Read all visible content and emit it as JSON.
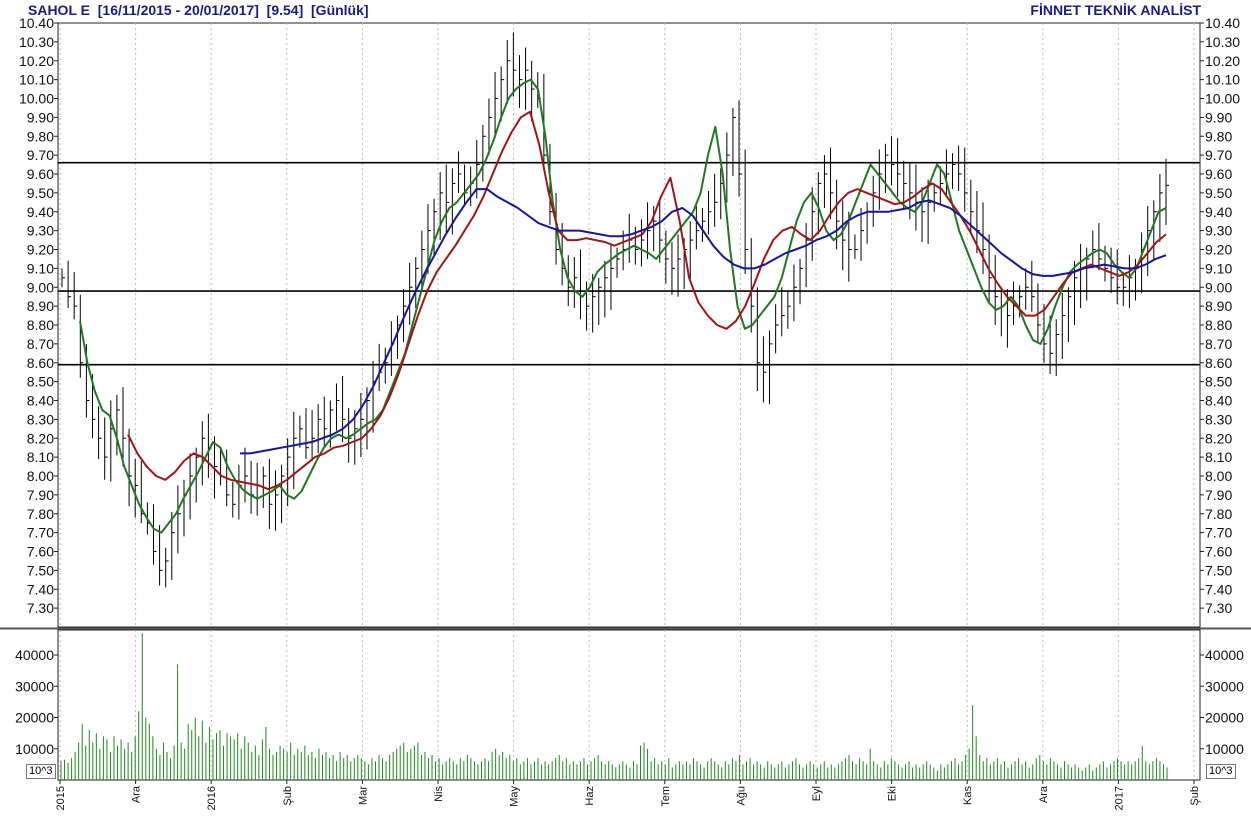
{
  "header": {
    "title": "SAHOL E  [16/11/2015 - 20/01/2017]  [9.54]  [Günlük]",
    "brand": "FİNNET TEKNİK ANALİST"
  },
  "volume_unit": "10^3",
  "colors": {
    "bars": "#000000",
    "ma_short": "#1f7a1f",
    "ma_mid": "#a01616",
    "ma_long": "#16169c",
    "volume": "#1f8a1f",
    "header": "#1a1a8c",
    "reference_lines": "#000000"
  },
  "chart_data": [
    {
      "type": "ohlc",
      "title": "SAHOL E  [16/11/2015 - 20/01/2017]  [9.54]  [Günlük]",
      "ylim": [
        7.2,
        10.4
      ],
      "yticks": [
        7.3,
        7.4,
        7.5,
        7.6,
        7.7,
        7.8,
        7.9,
        8.0,
        8.1,
        8.2,
        8.3,
        8.4,
        8.5,
        8.6,
        8.7,
        8.8,
        8.9,
        9.0,
        9.1,
        9.2,
        9.3,
        9.4,
        9.5,
        9.6,
        9.7,
        9.8,
        9.9,
        10.0,
        10.1,
        10.2,
        10.3,
        10.4
      ],
      "yticklabels": [
        "7.30",
        "7.40",
        "7.50",
        "7.60",
        "7.70",
        "7.80",
        "7.90",
        "8.00",
        "8.10",
        "8.20",
        "8.30",
        "8.40",
        "8.50",
        "8.60",
        "8.70",
        "8.80",
        "8.90",
        "9.00",
        "9.10",
        "9.20",
        "9.30",
        "9.40",
        "9.50",
        "9.60",
        "9.70",
        "9.80",
        "9.90",
        "10.00",
        "10.10",
        "10.20",
        "10.30",
        "10.40"
      ],
      "x_months": [
        "2015",
        "Ara",
        "2016",
        "Şub",
        "Mar",
        "Nis",
        "May",
        "Haz",
        "Tem",
        "Ağu",
        "Eyl",
        "Eki",
        "Kas",
        "Ara",
        "2017",
        "Şub"
      ],
      "horizontal_lines": [
        9.66,
        8.98,
        8.59
      ],
      "close_series": [
        9.05,
        8.95,
        8.9,
        8.6,
        8.4,
        8.3,
        8.2,
        8.1,
        8.25,
        8.35,
        8.2,
        8.0,
        7.95,
        7.8,
        7.75,
        7.6,
        7.5,
        7.55,
        7.7,
        7.8,
        7.9,
        8.0,
        8.1,
        8.2,
        8.15,
        8.05,
        8.0,
        7.9,
        7.85,
        7.95,
        8.0,
        7.9,
        7.95,
        8.0,
        7.85,
        7.9,
        8.0,
        8.1,
        8.2,
        8.25,
        8.15,
        8.2,
        8.3,
        8.25,
        8.35,
        8.4,
        8.3,
        8.2,
        8.25,
        8.3,
        8.4,
        8.5,
        8.55,
        8.6,
        8.7,
        8.8,
        8.9,
        9.0,
        9.1,
        9.2,
        9.3,
        9.4,
        9.5,
        9.45,
        9.55,
        9.6,
        9.5,
        9.55,
        9.65,
        9.8,
        9.9,
        10.0,
        10.1,
        10.2,
        10.15,
        10.1,
        10.15,
        10.05,
        10.0,
        9.7,
        9.4,
        9.2,
        9.1,
        9.0,
        9.05,
        8.95,
        8.9,
        8.95,
        9.0,
        9.05,
        9.1,
        9.15,
        9.2,
        9.25,
        9.2,
        9.25,
        9.3,
        9.35,
        9.25,
        9.15,
        9.1,
        9.15,
        9.2,
        9.25,
        9.3,
        9.35,
        9.4,
        9.45,
        9.55,
        9.7,
        9.9,
        9.6,
        9.2,
        8.9,
        8.6,
        8.55,
        8.7,
        8.8,
        8.85,
        8.9,
        9.0,
        9.1,
        9.25,
        9.4,
        9.55,
        9.6,
        9.5,
        9.35,
        9.25,
        9.2,
        9.2,
        9.3,
        9.4,
        9.5,
        9.6,
        9.7,
        9.65,
        9.6,
        9.55,
        9.5,
        9.45,
        9.4,
        9.45,
        9.5,
        9.55,
        9.6,
        9.65,
        9.6,
        9.5,
        9.4,
        9.3,
        9.2,
        9.05,
        8.95,
        8.9,
        8.85,
        8.9,
        8.95,
        9.0,
        8.95,
        8.8,
        8.7,
        8.65,
        8.75,
        8.85,
        8.95,
        9.05,
        9.1,
        9.15,
        9.2,
        9.15,
        9.1,
        9.05,
        9.0,
        9.0,
        9.05,
        9.1,
        9.2,
        9.3,
        9.4,
        9.5,
        9.54
      ],
      "series": [
        {
          "name": "",
          "color": "#1f7a1f",
          "values": [
            8.82,
            8.6,
            8.45,
            8.35,
            8.32,
            8.2,
            8.05,
            7.95,
            7.85,
            7.78,
            7.72,
            7.7,
            7.75,
            7.8,
            7.88,
            7.95,
            8.02,
            8.1,
            8.18,
            8.15,
            8.05,
            7.98,
            7.93,
            7.9,
            7.88,
            7.9,
            7.92,
            7.95,
            7.9,
            7.88,
            7.92,
            8.0,
            8.08,
            8.15,
            8.2,
            8.22,
            8.2,
            8.22,
            8.25,
            8.28,
            8.3,
            8.35,
            8.45,
            8.55,
            8.65,
            8.8,
            8.95,
            9.1,
            9.25,
            9.35,
            9.42,
            9.45,
            9.5,
            9.55,
            9.6,
            9.68,
            9.78,
            9.9,
            10.0,
            10.05,
            10.08,
            10.1,
            10.05,
            9.8,
            9.45,
            9.2,
            9.05,
            8.98,
            8.95,
            9.0,
            9.08,
            9.12,
            9.15,
            9.18,
            9.2,
            9.22,
            9.2,
            9.18,
            9.15,
            9.2,
            9.25,
            9.3,
            9.35,
            9.4,
            9.5,
            9.7,
            9.85,
            9.6,
            9.2,
            8.9,
            8.78,
            8.8,
            8.85,
            8.9,
            8.95,
            9.05,
            9.2,
            9.35,
            9.45,
            9.5,
            9.42,
            9.3,
            9.25,
            9.28,
            9.35,
            9.45,
            9.55,
            9.65,
            9.6,
            9.55,
            9.5,
            9.45,
            9.42,
            9.4,
            9.45,
            9.55,
            9.65,
            9.6,
            9.45,
            9.3,
            9.2,
            9.1,
            9.0,
            8.92,
            8.88,
            8.9,
            8.95,
            8.9,
            8.8,
            8.72,
            8.7,
            8.78,
            8.9,
            9.0,
            9.08,
            9.12,
            9.15,
            9.18,
            9.2,
            9.18,
            9.12,
            9.08,
            9.05,
            9.1,
            9.2,
            9.3,
            9.4,
            9.42
          ]
        },
        {
          "name": "",
          "color": "#a01616",
          "values": [
            8.22,
            8.12,
            8.05,
            8.0,
            7.98,
            8.02,
            8.08,
            8.12,
            8.1,
            8.05,
            8.0,
            7.98,
            7.97,
            7.96,
            7.95,
            7.93,
            7.95,
            7.98,
            8.02,
            8.06,
            8.1,
            8.12,
            8.15,
            8.16,
            8.18,
            8.2,
            8.25,
            8.32,
            8.42,
            8.55,
            8.7,
            8.85,
            8.98,
            9.08,
            9.15,
            9.22,
            9.3,
            9.38,
            9.48,
            9.6,
            9.72,
            9.82,
            9.9,
            9.93,
            9.75,
            9.5,
            9.3,
            9.25,
            9.25,
            9.26,
            9.25,
            9.24,
            9.22,
            9.24,
            9.26,
            9.28,
            9.35,
            9.48,
            9.58,
            9.35,
            9.05,
            8.92,
            8.85,
            8.8,
            8.78,
            8.82,
            8.9,
            9.02,
            9.15,
            9.25,
            9.3,
            9.32,
            9.28,
            9.25,
            9.3,
            9.38,
            9.45,
            9.5,
            9.52,
            9.5,
            9.48,
            9.46,
            9.44,
            9.45,
            9.48,
            9.52,
            9.55,
            9.52,
            9.45,
            9.38,
            9.3,
            9.2,
            9.1,
            9.02,
            8.95,
            8.9,
            8.85,
            8.85,
            8.88,
            8.95,
            9.02,
            9.08,
            9.1,
            9.12,
            9.1,
            9.08,
            9.06,
            9.08,
            9.12,
            9.18,
            9.24,
            9.28
          ]
        },
        {
          "name": "",
          "color": "#16169c",
          "values": [
            8.12,
            8.12,
            8.13,
            8.14,
            8.15,
            8.16,
            8.17,
            8.18,
            8.2,
            8.22,
            8.25,
            8.3,
            8.38,
            8.48,
            8.6,
            8.72,
            8.85,
            8.97,
            9.08,
            9.18,
            9.28,
            9.37,
            9.45,
            9.52,
            9.52,
            9.48,
            9.45,
            9.42,
            9.38,
            9.34,
            9.32,
            9.3,
            9.3,
            9.3,
            9.29,
            9.28,
            9.27,
            9.27,
            9.28,
            9.3,
            9.32,
            9.35,
            9.4,
            9.42,
            9.38,
            9.3,
            9.22,
            9.16,
            9.12,
            9.1,
            9.1,
            9.12,
            9.15,
            9.18,
            9.2,
            9.22,
            9.25,
            9.27,
            9.3,
            9.35,
            9.38,
            9.4,
            9.4,
            9.4,
            9.41,
            9.42,
            9.45,
            9.46,
            9.44,
            9.42,
            9.38,
            9.33,
            9.28,
            9.23,
            9.18,
            9.14,
            9.1,
            9.07,
            9.06,
            9.06,
            9.07,
            9.08,
            9.1,
            9.11,
            9.12,
            9.11,
            9.1,
            9.1,
            9.12,
            9.15,
            9.17
          ]
        }
      ]
    },
    {
      "type": "bar",
      "title": "",
      "ylim": [
        0,
        48000
      ],
      "yticks": [
        10000,
        20000,
        30000,
        40000
      ],
      "yticklabels": [
        "10000",
        "20000",
        "30000",
        "40000"
      ],
      "values": [
        6000,
        6500,
        5500,
        7000,
        9000,
        12000,
        18000,
        11000,
        16000,
        12000,
        15000,
        10000,
        14000,
        13000,
        9000,
        14000,
        11000,
        13000,
        10000,
        12000,
        9000,
        14000,
        22000,
        47000,
        20000,
        18000,
        14000,
        10000,
        8000,
        12000,
        9000,
        7000,
        11000,
        37000,
        12000,
        10000,
        18000,
        16000,
        20000,
        14000,
        19000,
        12000,
        17000,
        13000,
        15000,
        16000,
        11000,
        15000,
        14000,
        13000,
        15000,
        10000,
        14000,
        12000,
        9000,
        11000,
        8000,
        13000,
        17000,
        10000,
        8000,
        9000,
        11000,
        10000,
        9000,
        12000,
        8000,
        10000,
        9000,
        11000,
        8000,
        9000,
        7000,
        10000,
        8000,
        9000,
        7000,
        8000,
        6000,
        9000,
        7000,
        8000,
        6000,
        7000,
        8000,
        7000,
        6000,
        5000,
        7000,
        6000,
        8000,
        7000,
        6000,
        8000,
        9000,
        10000,
        11000,
        12000,
        9000,
        10000,
        11000,
        12000,
        8000,
        9000,
        7000,
        8000,
        6000,
        7000,
        5000,
        6000,
        7000,
        6000,
        5000,
        7000,
        6000,
        8000,
        7000,
        6000,
        5000,
        6000,
        7000,
        6000,
        9000,
        10000,
        8000,
        9000,
        7000,
        8000,
        6000,
        7000,
        5000,
        6000,
        7000,
        5000,
        6000,
        7000,
        5000,
        6000,
        5000,
        6000,
        7000,
        8000,
        6000,
        7000,
        5000,
        6000,
        5000,
        6000,
        7000,
        5000,
        6000,
        7000,
        8000,
        6000,
        5000,
        6000,
        5000,
        4000,
        5000,
        6000,
        5000,
        4000,
        6000,
        5000,
        11000,
        12000,
        10000,
        6000,
        7000,
        5000,
        6000,
        5000,
        7000,
        4000,
        5000,
        6000,
        5000,
        6000,
        5000,
        7000,
        6000,
        5000,
        4000,
        6000,
        7000,
        6000,
        5000,
        4000,
        6000,
        5000,
        7000,
        6000,
        8000,
        5000,
        6000,
        7000,
        5000,
        6000,
        5000,
        4000,
        6000,
        5000,
        4000,
        5000,
        6000,
        4000,
        5000,
        6000,
        7000,
        5000,
        4000,
        5000,
        6000,
        5000,
        4000,
        5000,
        6000,
        4000,
        5000,
        4000,
        5000,
        6000,
        7000,
        8000,
        6000,
        5000,
        7000,
        6000,
        5000,
        10000,
        6000,
        5000,
        4000,
        6000,
        5000,
        7000,
        6000,
        5000,
        4000,
        5000,
        6000,
        4000,
        5000,
        4000,
        5000,
        6000,
        5000,
        4000,
        3000,
        5000,
        4000,
        5000,
        6000,
        7000,
        5000,
        6000,
        8000,
        10000,
        24000,
        14000,
        8000,
        6000,
        7000,
        5000,
        6000,
        7000,
        5000,
        6000,
        4000,
        5000,
        6000,
        7000,
        5000,
        6000,
        4000,
        5000,
        7000,
        8000,
        6000,
        5000,
        7000,
        6000,
        5000,
        4000,
        6000,
        5000,
        4000,
        5000,
        4000,
        3000,
        4000,
        5000,
        3000,
        4000,
        5000,
        6000,
        4000,
        5000,
        6000,
        7000,
        6000,
        5000,
        6000,
        5000,
        6000,
        7000,
        11000,
        6000,
        5000,
        6000,
        7000,
        6000,
        5000,
        4000
      ]
    }
  ]
}
